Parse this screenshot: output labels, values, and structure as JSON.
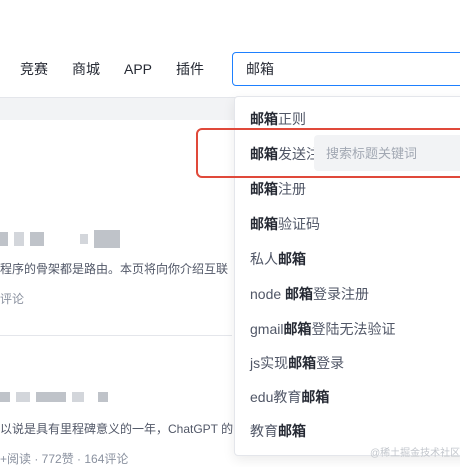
{
  "nav": {
    "items": [
      "竞赛",
      "商城",
      "APP",
      "插件"
    ]
  },
  "search": {
    "value": "邮箱"
  },
  "suggestions": [
    {
      "hl": "邮箱",
      "rest": "正则",
      "hl_first": true
    },
    {
      "hl": "邮箱",
      "rest": "发送注",
      "hl_first": true
    },
    {
      "hl": "邮箱",
      "rest": "注册",
      "hl_first": true
    },
    {
      "hl": "邮箱",
      "rest": "验证码",
      "hl_first": true
    },
    {
      "pre": "私人",
      "hl": "邮箱",
      "hl_first": false
    },
    {
      "pre": "node ",
      "hl": "邮箱",
      "rest": "登录注册",
      "hl_first": false
    },
    {
      "pre": "gmail",
      "hl": "邮箱",
      "rest": "登陆无法验证",
      "hl_first": false
    },
    {
      "pre": "js实现",
      "hl": "邮箱",
      "rest": "登录",
      "hl_first": false
    },
    {
      "pre": "edu教育",
      "hl": "邮箱",
      "hl_first": false
    },
    {
      "pre": "教育",
      "hl": "邮箱",
      "hl_first": false
    }
  ],
  "filter": {
    "placeholder": "搜索标题关键词"
  },
  "articles": [
    {
      "text": "程序的骨架都是路由。本页将向你介绍互联",
      "meta": "评论"
    },
    {
      "text": "以说是具有里程碑意义的一年，ChatGPT 的",
      "meta": "+阅读 · 772赞 · 164评论"
    }
  ],
  "watermark": "@稀土掘金技术社区",
  "colors": {
    "accent": "#1e80ff",
    "annotation": "#e0493a"
  }
}
